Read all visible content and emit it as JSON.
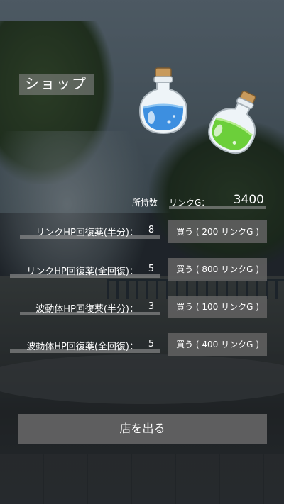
{
  "shop": {
    "title": "ショップ"
  },
  "wallet": {
    "owned_label": "所持数",
    "currency_label": "リンクG：",
    "amount": "3400"
  },
  "items": [
    {
      "name": "リンクHP回復薬(半分)：",
      "count": "8",
      "buy_label": "買う ( 200 リンクG )"
    },
    {
      "name": "リンクHP回復薬(全回復)：",
      "count": "5",
      "buy_label": "買う ( 800 リンクG )"
    },
    {
      "name": "波動体HP回復薬(半分)：",
      "count": "3",
      "buy_label": "買う ( 100 リンクG )"
    },
    {
      "name": "波動体HP回復薬(全回復)：",
      "count": "5",
      "buy_label": "買う ( 400 リンクG )"
    }
  ],
  "exit": {
    "label": "店を出る"
  },
  "icons": {
    "potion_blue": "blue-potion-icon",
    "potion_green": "green-potion-icon"
  },
  "colors": {
    "potion_blue": "#3d8fe0",
    "potion_green": "#6ccf3a",
    "button": "#5f5f5f"
  }
}
